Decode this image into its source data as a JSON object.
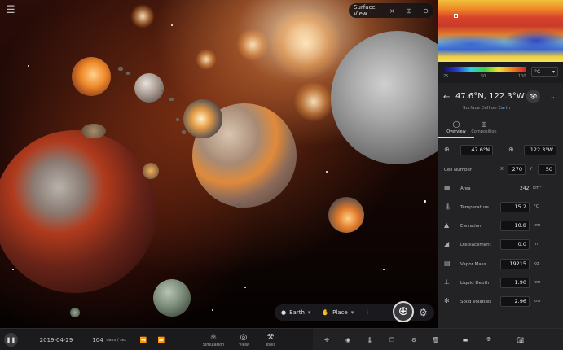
{
  "surface_view": {
    "label": "Surface View",
    "close": "×"
  },
  "bottom_pill": {
    "body": "Earth",
    "tool": "Place"
  },
  "bottombar": {
    "date": "2019-04-29",
    "speed_value": "104",
    "speed_unit": "days / sec",
    "tools": [
      {
        "label": "Simulation",
        "icon": "simulation-icon"
      },
      {
        "label": "View",
        "icon": "view-icon"
      },
      {
        "label": "Tools",
        "icon": "tools-icon"
      }
    ]
  },
  "panel": {
    "legend": {
      "ticks": [
        "25",
        "50",
        "100"
      ],
      "unit": "°C"
    },
    "coords_title": "47.6°N, 122.3°W",
    "cell_prefix": "Surface Cell on",
    "cell_planet": "Earth",
    "tabs": [
      {
        "label": "Overview",
        "active": true
      },
      {
        "label": "Composition",
        "active": false
      }
    ],
    "lat_value": "47.6°N",
    "lon_value": "122.3°W",
    "cell_number_label": "Cell Number",
    "cell_x_label": "X",
    "cell_x_value": "270",
    "cell_y_label": "Y",
    "cell_y_value": "50",
    "rows": [
      {
        "label": "Area",
        "value": "242",
        "unit": "km²"
      },
      {
        "label": "Temperature",
        "value": "15.2",
        "unit": "°C"
      },
      {
        "label": "Elevation",
        "value": "10.8",
        "unit": "km"
      },
      {
        "label": "Displacement",
        "value": "0.0",
        "unit": "m"
      },
      {
        "label": "Vapor Mass",
        "value": "19215",
        "unit": "kg"
      },
      {
        "label": "Liquid Depth",
        "value": "1.90",
        "unit": "km"
      },
      {
        "label": "Solid Volatiles",
        "value": "2.96",
        "unit": "km"
      }
    ]
  },
  "colors": {
    "panel_bg": "#232326",
    "accent_link": "#6aa8e8"
  }
}
